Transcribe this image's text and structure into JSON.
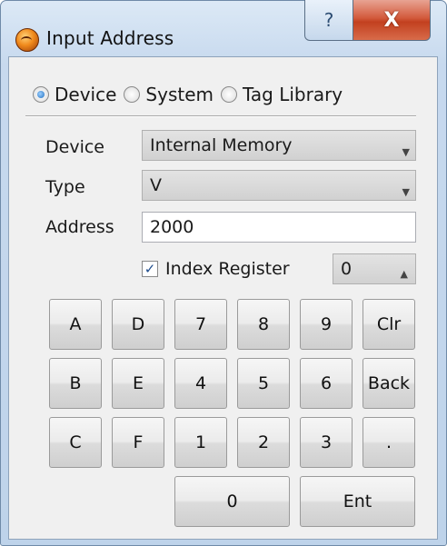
{
  "window": {
    "title": "Input Address",
    "help_symbol": "?",
    "close_symbol": "X",
    "icon": "app-orb-icon"
  },
  "source": {
    "options": [
      "Device",
      "System",
      "Tag Library"
    ],
    "selected": "Device"
  },
  "form": {
    "device_label": "Device",
    "device_value": "Internal Memory",
    "type_label": "Type",
    "type_value": "V",
    "address_label": "Address",
    "address_value": "2000",
    "index_register_label": "Index Register",
    "index_register_checked": true,
    "index_register_value": "0",
    "check_mark": "✓",
    "dropdown_arrow": "▼",
    "spin_arrow": "▲"
  },
  "keypad": {
    "rows": [
      [
        "A",
        "D",
        "7",
        "8",
        "9",
        "Clr"
      ],
      [
        "B",
        "E",
        "4",
        "5",
        "6",
        "Back"
      ],
      [
        "C",
        "F",
        "1",
        "2",
        "3",
        "."
      ],
      [
        "0",
        "Ent"
      ]
    ]
  }
}
